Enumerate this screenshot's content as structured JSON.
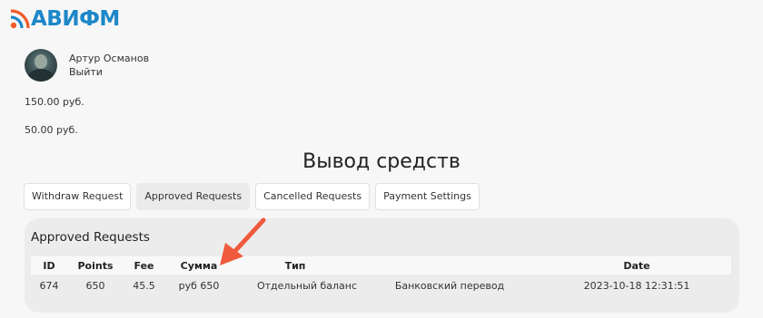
{
  "brand": {
    "name": "АВИФМ"
  },
  "user": {
    "name": "Артур Османов",
    "logout": "Выйти"
  },
  "balances": [
    "150.00 руб.",
    "50.00 руб."
  ],
  "page": {
    "title": "Вывод средств"
  },
  "tabs": [
    {
      "label": "Withdraw Request",
      "active": false
    },
    {
      "label": "Approved Requests",
      "active": true
    },
    {
      "label": "Cancelled Requests",
      "active": false
    },
    {
      "label": "Payment Settings",
      "active": false
    }
  ],
  "approved": {
    "title": "Approved Requests",
    "columns": [
      "ID",
      "Points",
      "Fee",
      "Сумма",
      "Тип",
      "",
      "Date"
    ],
    "rows": [
      [
        "674",
        "650",
        "45.5",
        "руб 650",
        "Отдельный баланс",
        "Банковский перевод",
        "2023-10-18 12:31:51"
      ]
    ]
  },
  "watermark": "",
  "colors": {
    "brand_blue": "#1e87c8",
    "brand_orange": "#f05a28",
    "arrow": "#f05a3c",
    "card_bg": "#ececec"
  }
}
